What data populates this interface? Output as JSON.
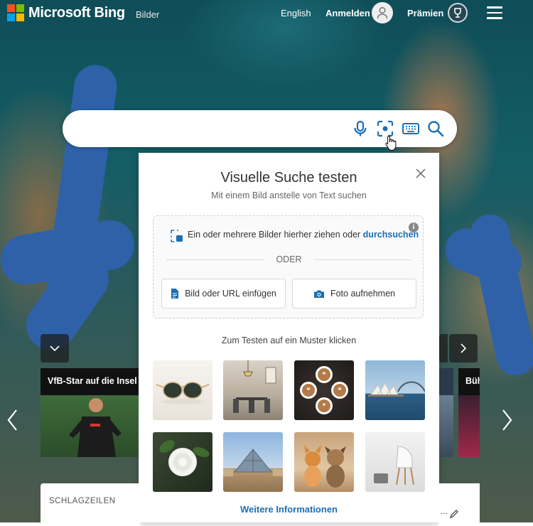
{
  "header": {
    "brand": "Microsoft Bing",
    "section": "Bilder",
    "language": "English",
    "signin": "Anmelden",
    "rewards": "Prämien"
  },
  "search": {
    "value": "",
    "placeholder": ""
  },
  "visual_search": {
    "title": "Visuelle Suche testen",
    "subtitle": "Mit einem Bild anstelle von Text suchen",
    "drop_text": "Ein oder mehrere Bilder hierher ziehen oder ",
    "drop_link": "durchsuchen",
    "or_label": "ODER",
    "paste_button": "Bild oder URL einfügen",
    "photo_button": "Foto aufnehmen",
    "sample_prompt": "Zum Testen auf ein Muster klicken",
    "samples": [
      "sunglasses",
      "dining-room",
      "latte-art",
      "sydney-opera-house",
      "white-rose",
      "louvre-pyramid",
      "dogs",
      "white-chair"
    ],
    "more_info": "Weitere Informationen"
  },
  "carousel": {
    "card1_title": "VfB-Star auf die Insel",
    "card2_title": "Büh"
  },
  "headlines": {
    "label": "SCHLAGZEILEN",
    "right_text": "..."
  },
  "colors": {
    "accent": "#1a6fb5",
    "search_icons": "#1a6fb5",
    "ms_red": "#f25022",
    "ms_green": "#7fba00",
    "ms_blue": "#00a4ef",
    "ms_yellow": "#ffb900"
  }
}
